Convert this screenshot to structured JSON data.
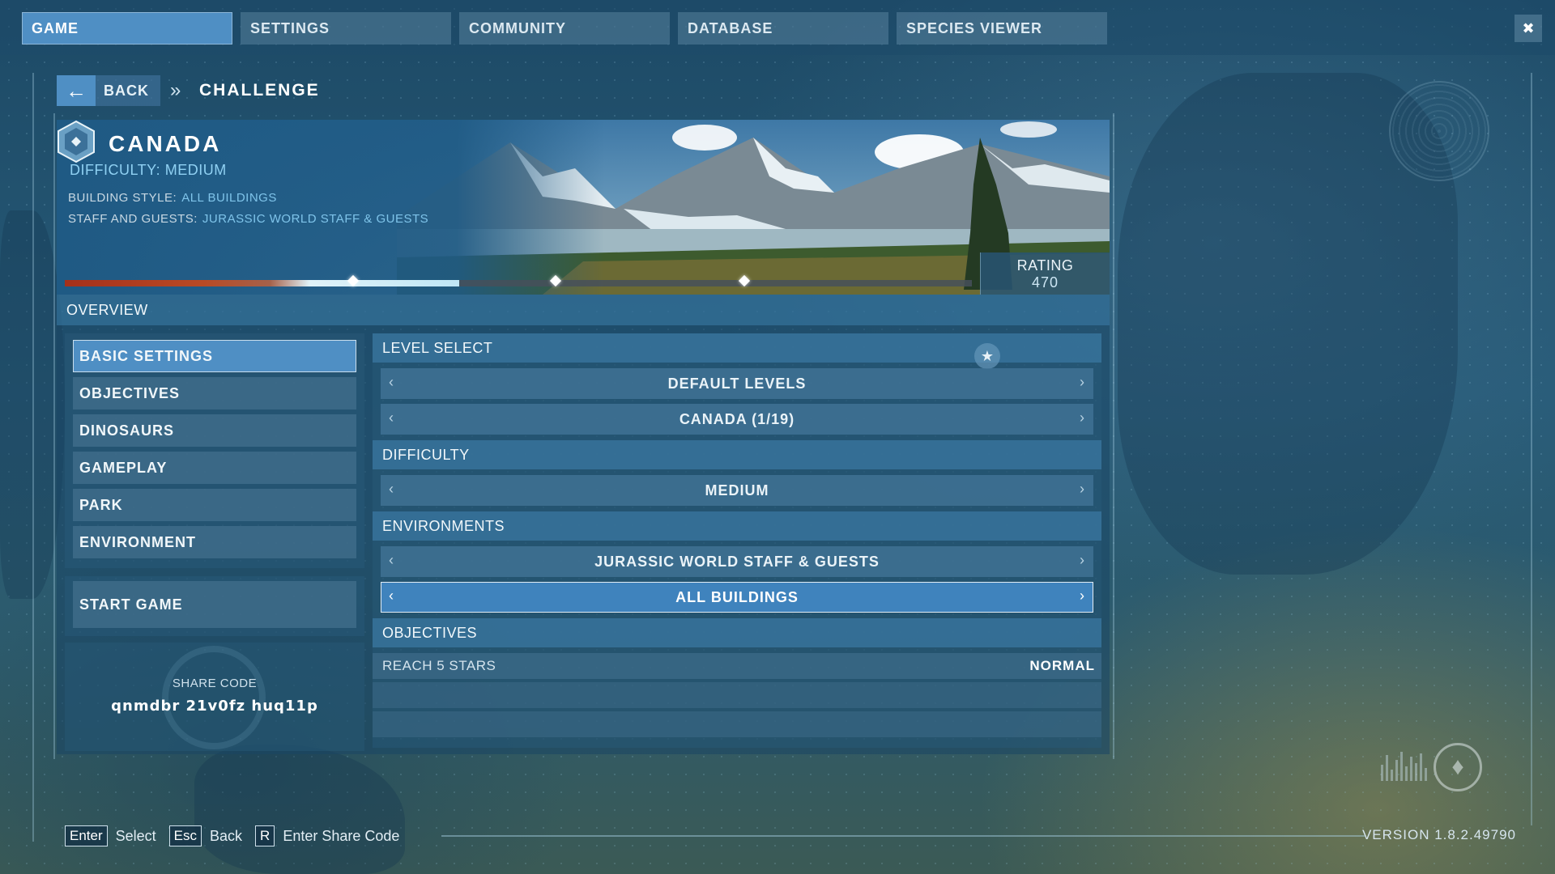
{
  "nav": {
    "tabs": [
      {
        "label": "GAME",
        "active": true
      },
      {
        "label": "SETTINGS",
        "active": false
      },
      {
        "label": "COMMUNITY",
        "active": false
      },
      {
        "label": "DATABASE",
        "active": false
      },
      {
        "label": "SPECIES VIEWER",
        "active": false
      }
    ],
    "close_icon": "collapse-arrows-icon"
  },
  "breadcrumb": {
    "back_label": "BACK",
    "separator_icon": "double-chevron-right-icon",
    "title": "CHALLENGE"
  },
  "hero": {
    "flag_icon": "canada-flag-icon",
    "country": "CANADA",
    "difficulty_label": "DIFFICULTY:",
    "difficulty_value": "MEDIUM",
    "building_style_label": "BUILDING STYLE:",
    "building_style_value": "ALL BUILDINGS",
    "staff_label": "STAFF AND GUESTS:",
    "staff_value": "JURASSIC WORLD STAFF & GUESTS",
    "rating_label": "RATING",
    "rating_value": "470",
    "progress_fraction": 0.435,
    "milestone_fractions": [
      0.318,
      0.541,
      0.749
    ]
  },
  "overview": {
    "label": "OVERVIEW"
  },
  "menu": {
    "items": [
      {
        "label": "BASIC SETTINGS",
        "active": true
      },
      {
        "label": "OBJECTIVES",
        "active": false
      },
      {
        "label": "DINOSAURS",
        "active": false
      },
      {
        "label": "GAMEPLAY",
        "active": false
      },
      {
        "label": "PARK",
        "active": false
      },
      {
        "label": "ENVIRONMENT",
        "active": false
      }
    ],
    "start_label": "START GAME",
    "share_label": "SHARE CODE",
    "share_code": "qnmdbr 21v0fz huq11p"
  },
  "settings": {
    "level_select_label": "LEVEL SELECT",
    "level_options": [
      "DEFAULT LEVELS",
      "CANADA (1/19)"
    ],
    "difficulty_label": "DIFFICULTY",
    "difficulty_value": "MEDIUM",
    "environments_label": "ENVIRONMENTS",
    "environment_options": [
      "JURASSIC WORLD STAFF & GUESTS",
      "ALL BUILDINGS"
    ],
    "objectives_label": "OBJECTIVES",
    "objective_name": "REACH 5 STARS",
    "objective_level": "NORMAL"
  },
  "footer": {
    "hints": [
      {
        "key": "Enter",
        "text": "Select"
      },
      {
        "key": "Esc",
        "text": "Back"
      },
      {
        "key": "R",
        "text": "Enter Share Code"
      }
    ],
    "version": "VERSION 1.8.2.49790"
  },
  "colors": {
    "accent": "#4f8fc4",
    "progress_red": "#a5301a",
    "text_highlight": "#8fd0f2"
  }
}
